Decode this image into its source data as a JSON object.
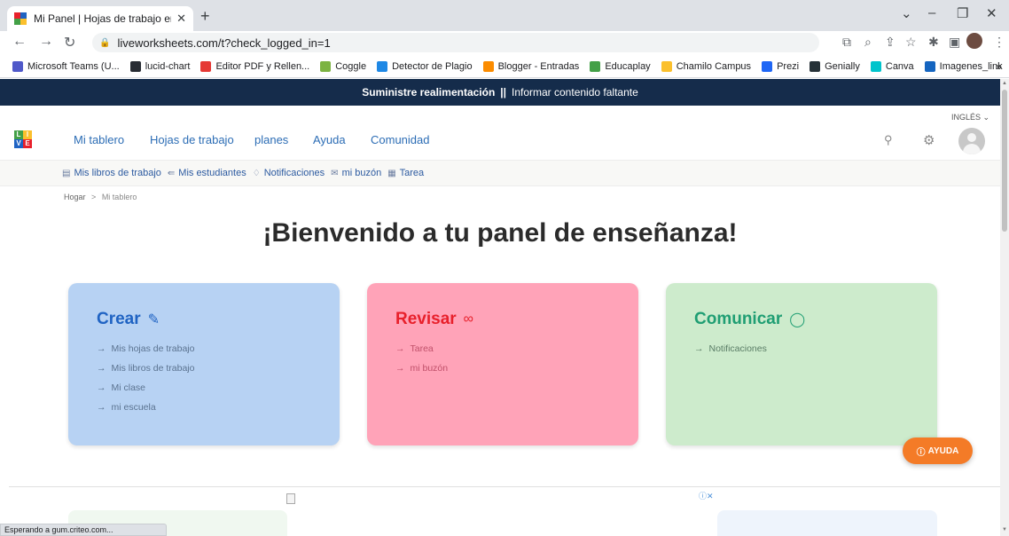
{
  "browser": {
    "tab_title": "Mi Panel | Hojas de trabajo en vi",
    "url": "liveworksheets.com/t?check_logged_in=1",
    "bookmarks": [
      {
        "label": "Microsoft Teams (U...",
        "color": "#5059c9"
      },
      {
        "label": "lucid-chart",
        "color": "#282c33"
      },
      {
        "label": "Editor PDF y Rellen...",
        "color": "#e53935"
      },
      {
        "label": "Coggle",
        "color": "#7cb342"
      },
      {
        "label": "Detector de Plagio",
        "color": "#1e88e5"
      },
      {
        "label": "Blogger - Entradas",
        "color": "#fb8c00"
      },
      {
        "label": "Educaplay",
        "color": "#43a047"
      },
      {
        "label": "Chamilo Campus",
        "color": "#fbc02d"
      },
      {
        "label": "Prezi",
        "color": "#1e66f5"
      },
      {
        "label": "Genially",
        "color": "#263238"
      },
      {
        "label": "Canva",
        "color": "#00c4cc"
      },
      {
        "label": "Imagenes_link",
        "color": "#1565c0"
      }
    ],
    "status_text": "Esperando a gum.criteo.com..."
  },
  "topbar": {
    "feedback": "Suministre realimentación",
    "separator": "||",
    "report": "Informar contenido faltante"
  },
  "header": {
    "language": "INGLÉS ⌄",
    "logo_letters": [
      "L",
      "I",
      "V",
      "E"
    ],
    "nav": [
      "Mi tablero",
      "Hojas de trabajo",
      "planes",
      "Ayuda",
      "Comunidad"
    ]
  },
  "subnav": [
    {
      "label": "Mis libros de trabajo",
      "icon": "book-icon"
    },
    {
      "label": "Mis estudiantes",
      "icon": "students-icon"
    },
    {
      "label": "Notificaciones",
      "icon": "bell-icon"
    },
    {
      "label": "mi buzón",
      "icon": "mail-icon"
    },
    {
      "label": "Tarea",
      "icon": "calendar-icon"
    }
  ],
  "breadcrumb": {
    "home": "Hogar",
    "separator": ">",
    "current": "Mi tablero"
  },
  "welcome": "¡Bienvenido a tu panel de enseñanza!",
  "cards": {
    "crear": {
      "title": "Crear",
      "icon": "pencil-icon",
      "links": [
        "Mis hojas de trabajo",
        "Mis libros de trabajo",
        "Mi clase",
        "mi escuela"
      ]
    },
    "revisar": {
      "title": "Revisar",
      "icon": "binoculars-icon",
      "links": [
        "Tarea",
        "mi buzón"
      ]
    },
    "comunicar": {
      "title": "Comunicar",
      "icon": "chat-bubble-icon",
      "links": [
        "Notificaciones"
      ]
    }
  },
  "help_button": "AYUDA",
  "ad_choices": "ⓘ✕",
  "colors": {
    "topbar": "#152c4b",
    "nav_link": "#2c6db5",
    "crear_bg": "#b7d2f3",
    "revisar_bg": "#ffa3b8",
    "comunicar_bg": "#cdebcc",
    "help_button": "#f47b27"
  }
}
